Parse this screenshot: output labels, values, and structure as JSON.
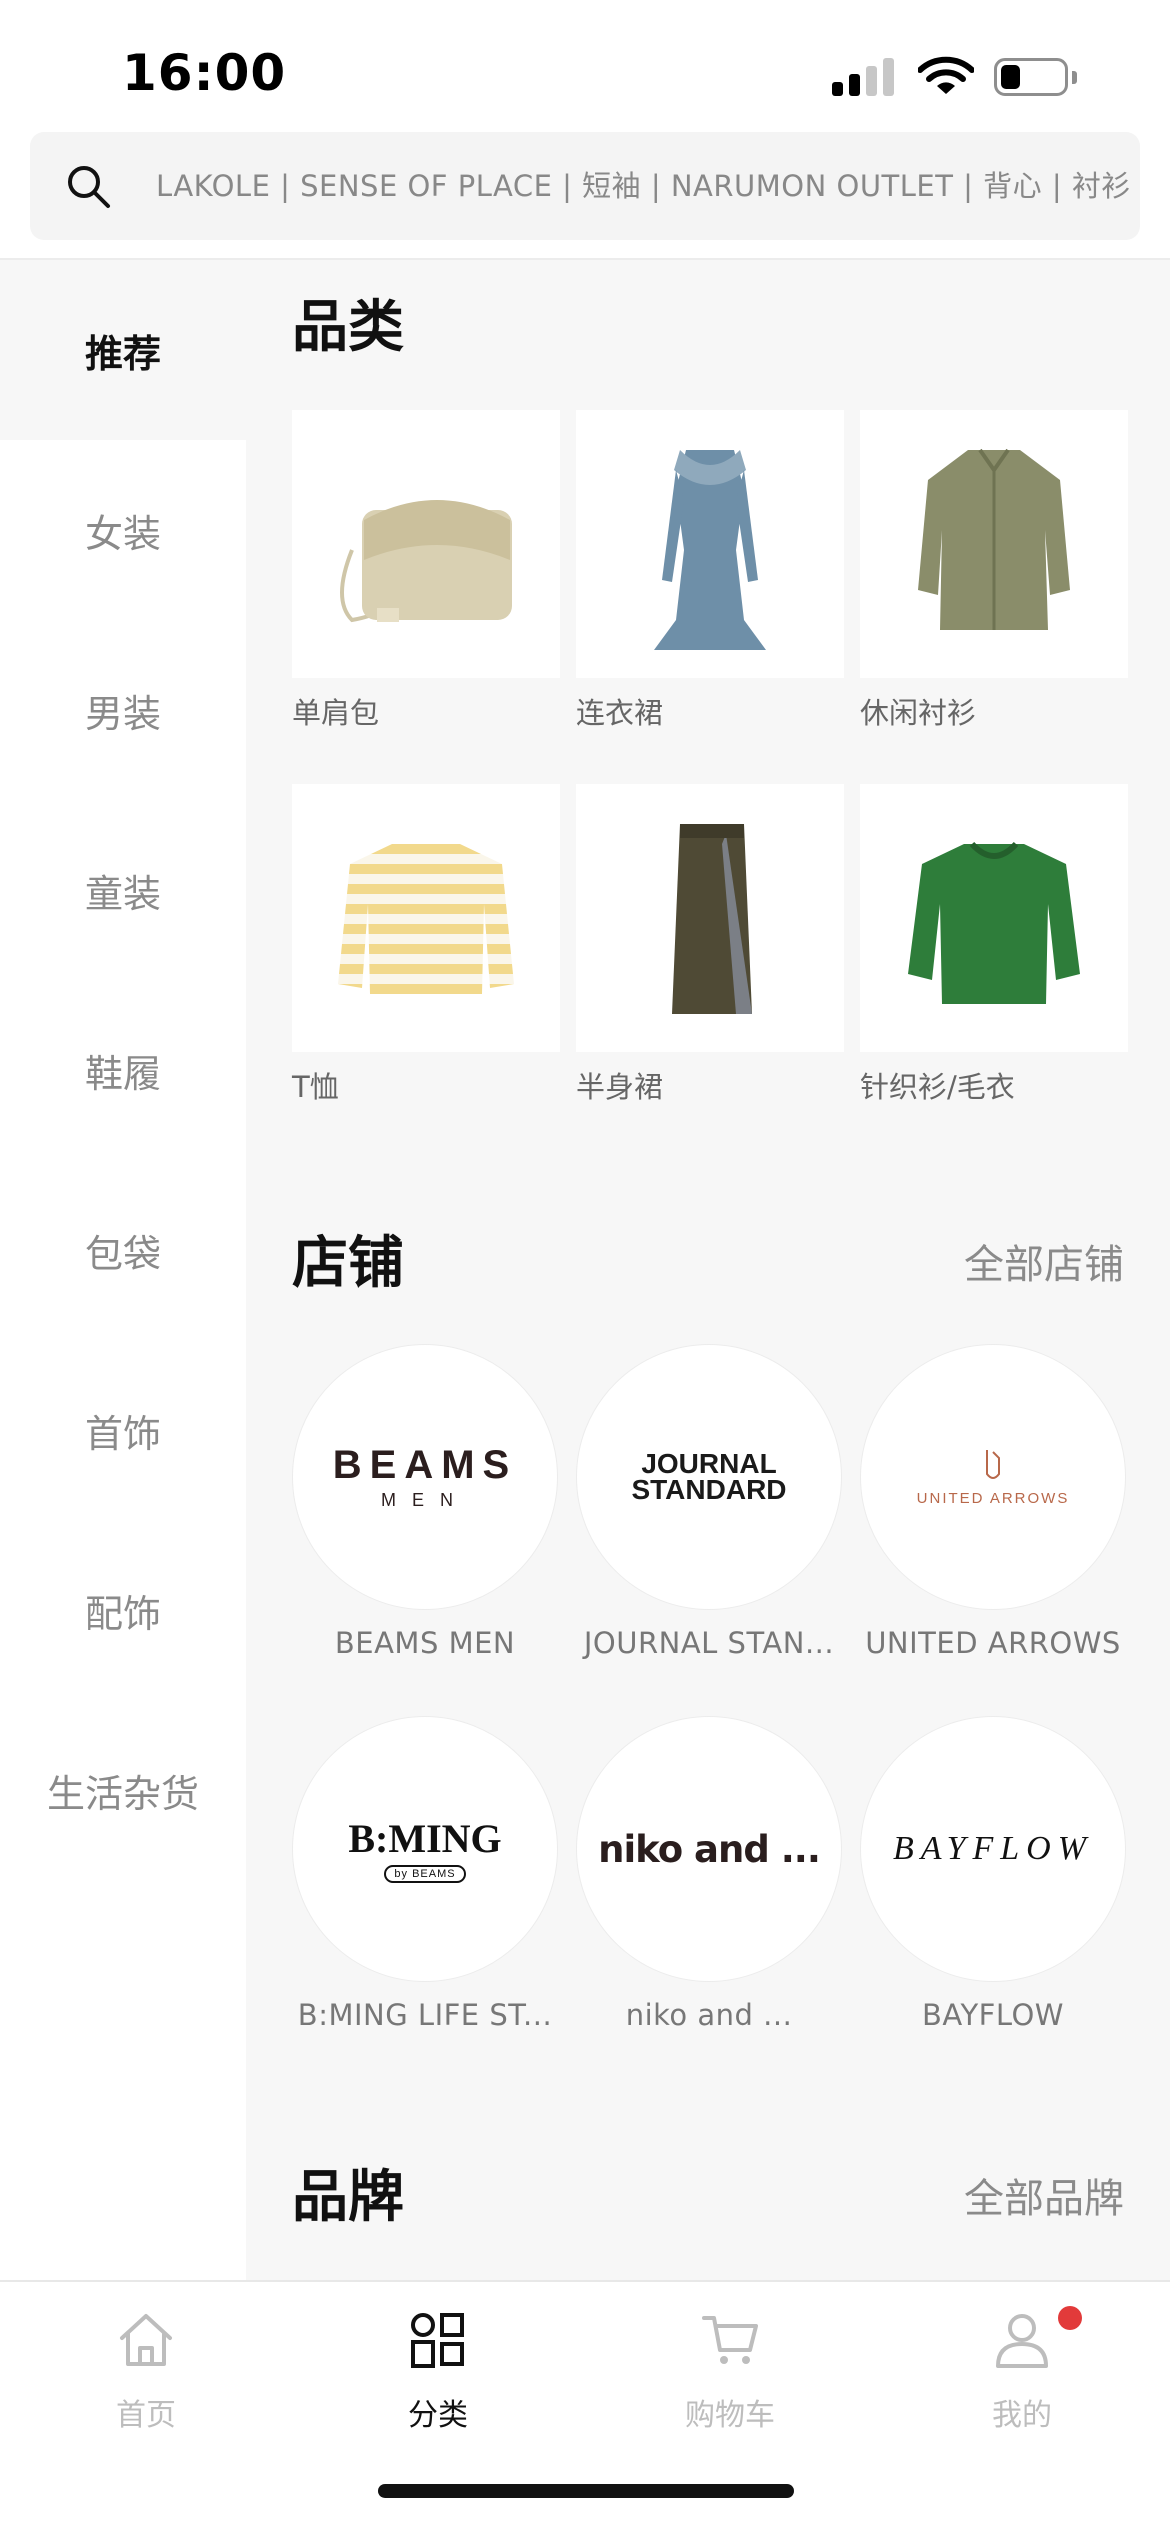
{
  "status": {
    "time": "16:00",
    "battery_level": 0.25
  },
  "search": {
    "placeholder": "LAKOLE | SENSE OF PLACE | 短袖 | NARUMON OUTLET | 背心 | 衬衫"
  },
  "sidebar": {
    "items": [
      {
        "label": "推荐",
        "active": true
      },
      {
        "label": "女装",
        "active": false
      },
      {
        "label": "男装",
        "active": false
      },
      {
        "label": "童装",
        "active": false
      },
      {
        "label": "鞋履",
        "active": false
      },
      {
        "label": "包袋",
        "active": false
      },
      {
        "label": "首饰",
        "active": false
      },
      {
        "label": "配饰",
        "active": false
      },
      {
        "label": "生活杂货",
        "active": false
      }
    ]
  },
  "categories": {
    "title": "品类",
    "items": [
      {
        "label": "单肩包",
        "icon": "shoulder-bag-image"
      },
      {
        "label": "连衣裙",
        "icon": "dress-image"
      },
      {
        "label": "休闲衬衫",
        "icon": "casual-shirt-image"
      },
      {
        "label": "T恤",
        "icon": "striped-tshirt-image"
      },
      {
        "label": "半身裙",
        "icon": "skirt-image"
      },
      {
        "label": "针织衫/毛衣",
        "icon": "sweater-image"
      }
    ]
  },
  "stores": {
    "title": "店铺",
    "more_label": "全部店铺",
    "items": [
      {
        "label": "BEAMS MEN",
        "logo_main": "BEAMS",
        "logo_sub": "MEN"
      },
      {
        "label": "JOURNAL STAN...",
        "logo_main": "JOURNAL",
        "logo_sub": "STANDARD"
      },
      {
        "label": "UNITED ARROWS",
        "logo_main": "UNITED ARROWS"
      },
      {
        "label": "B:MING LIFE ST...",
        "logo_main": "B:MING",
        "logo_sub": "by BEAMS"
      },
      {
        "label": "niko and ...",
        "logo_main": "niko and ..."
      },
      {
        "label": "BAYFLOW",
        "logo_main": "BAYFLOW"
      }
    ]
  },
  "brands": {
    "title": "品牌",
    "more_label": "全部品牌"
  },
  "tabbar": {
    "items": [
      {
        "label": "首页",
        "icon": "home-icon",
        "active": false
      },
      {
        "label": "分类",
        "icon": "category-icon",
        "active": true
      },
      {
        "label": "购物车",
        "icon": "cart-icon",
        "active": false
      },
      {
        "label": "我的",
        "icon": "profile-icon",
        "active": false
      }
    ]
  },
  "colors": {
    "accent": "#111111",
    "muted": "#8a8a8a",
    "badge": "#e23a3a",
    "panel": "#f7f7f7"
  }
}
